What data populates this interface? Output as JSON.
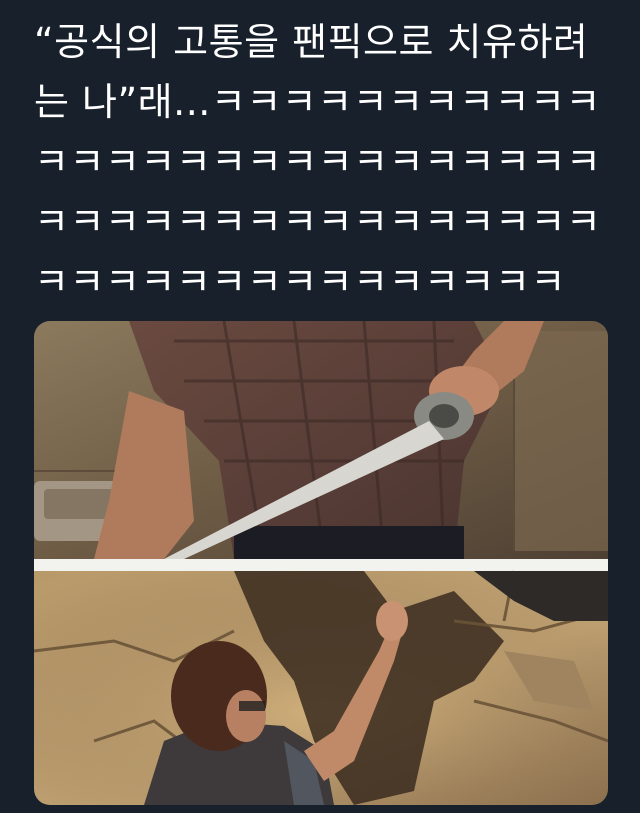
{
  "tweet": {
    "text": "“공식의 고통을 팬픽으로 치유하려는 나”래...ㅋㅋㅋㅋㅋㅋㅋㅋㅋㅋㅋㅋㅋㅋㅋㅋㅋㅋㅋㅋㅋㅋㅋㅋㅋㅋㅋㅋㅋㅋㅋㅋㅋㅋㅋㅋㅋㅋㅋㅋㅋㅋㅋㅋㅋㅋㅋㅋㅋㅋㅋㅋㅋㅋㅋㅋㅋㅋ"
  },
  "media": {
    "panels": [
      "man-pulling-duct-tape",
      "man-reaching-up-at-cracked-wall"
    ]
  },
  "colors": {
    "background": "#17202b",
    "text": "#ffffff"
  }
}
